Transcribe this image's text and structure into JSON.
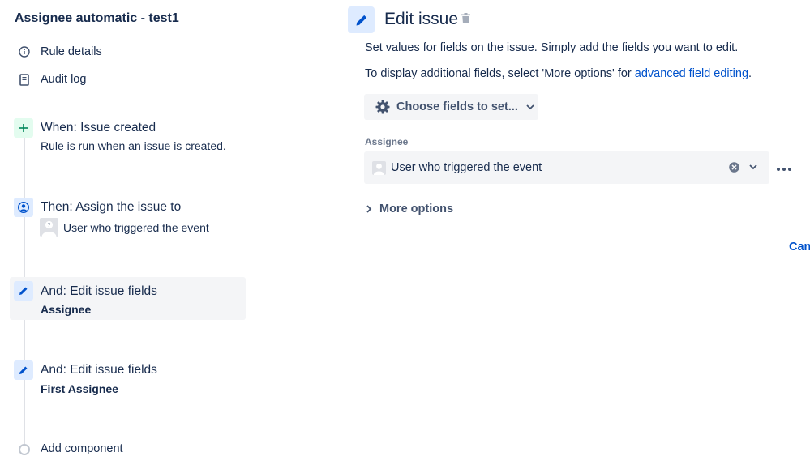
{
  "rule": {
    "title": "Assignee automatic - test1",
    "nav": [
      {
        "label": "Rule details",
        "icon": "info-icon"
      },
      {
        "label": "Audit log",
        "icon": "document-icon"
      }
    ]
  },
  "steps": {
    "trigger": {
      "title": "When: Issue created",
      "subtitle": "Rule is run when an issue is created."
    },
    "assign": {
      "title": "Then: Assign the issue to",
      "subtitle": "User who triggered the event"
    },
    "edit1": {
      "title": "And: Edit issue fields",
      "subtitle": "Assignee"
    },
    "edit2": {
      "title": "And: Edit issue fields",
      "subtitle": "First Assignee"
    },
    "add": {
      "label": "Add component"
    }
  },
  "panel": {
    "title": "Edit issue",
    "description": "Set values for fields on the issue. Simply add the fields you want to edit.",
    "more_prefix": "To display additional fields, select 'More options' for ",
    "more_link": "advanced field editing",
    "more_suffix": ".",
    "choose_button": "Choose fields to set...",
    "field_label": "Assignee",
    "field_value": "User who triggered the event",
    "more_options": "More options",
    "cancel": "Cancel"
  },
  "colors": {
    "trigger_icon_bg": "#e3fcef",
    "trigger_icon_fg": "#00875a",
    "action_icon_bg": "#deebff",
    "action_icon_fg": "#0052cc",
    "link": "#0052cc"
  }
}
